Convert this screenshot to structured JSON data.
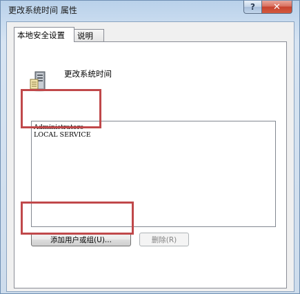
{
  "window": {
    "title": "更改系统时间 属性",
    "help_glyph": "?",
    "close_glyph": "✕"
  },
  "tabs": [
    {
      "label": "本地安全设置",
      "active": true
    },
    {
      "label": "说明",
      "active": false
    }
  ],
  "policy": {
    "name": "更改系统时间",
    "icon": "server-icon"
  },
  "accounts": [
    "Administrators",
    "LOCAL SERVICE"
  ],
  "buttons": {
    "add": "添加用户或组(U)...",
    "remove": "删除(R)"
  },
  "colors": {
    "annotation": "#c0484a",
    "close_button": "#c7432f"
  }
}
